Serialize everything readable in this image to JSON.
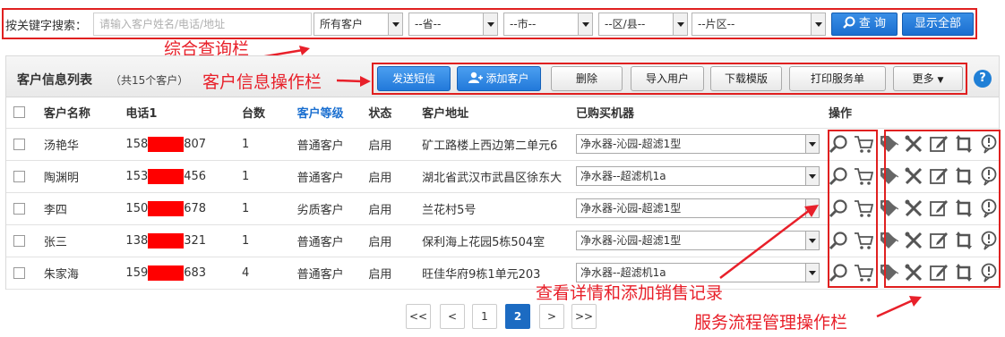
{
  "search": {
    "label": "按关键字搜索：",
    "placeholder": "请输入客户姓名/电话/地址",
    "customer_type": "所有客户",
    "province": "--省--",
    "city": "--市--",
    "district": "--区/县--",
    "area": "--片区--",
    "query_btn": "查 询",
    "show_all_btn": "显示全部"
  },
  "annotations": {
    "search_bar": "综合查询栏",
    "ops_bar": "客户信息操作栏",
    "detail": "查看详情和添加销售记录",
    "service": "服务流程管理操作栏"
  },
  "list": {
    "title": "客户信息列表",
    "count": "（共15个客户）",
    "buttons": {
      "sms": "发送短信",
      "add": "添加客户",
      "delete": "删除",
      "import": "导入用户",
      "download": "下载模版",
      "print": "打印服务单",
      "more": "更多"
    },
    "columns": [
      "客户名称",
      "电话1",
      "台数",
      "客户等级",
      "状态",
      "客户地址",
      "已购买机器",
      "操作"
    ],
    "rows": [
      {
        "name": "汤艳华",
        "phone_a": "158",
        "phone_b": "807",
        "count": "1",
        "level": "普通客户",
        "status": "启用",
        "address": "矿工路楼上西边第二单元6",
        "machine": "净水器-沁园-超滤1型"
      },
      {
        "name": "陶渊明",
        "phone_a": "153",
        "phone_b": "456",
        "count": "1",
        "level": "普通客户",
        "status": "启用",
        "address": "湖北省武汉市武昌区徐东大",
        "machine": "净水器--超滤机1a"
      },
      {
        "name": "李四",
        "phone_a": "150",
        "phone_b": "678",
        "count": "1",
        "level": "劣质客户",
        "status": "启用",
        "address": "兰花村5号",
        "machine": "净水器-沁园-超滤1型"
      },
      {
        "name": "张三",
        "phone_a": "138",
        "phone_b": "321",
        "count": "1",
        "level": "普通客户",
        "status": "启用",
        "address": "保利海上花园5栋504室",
        "machine": "净水器-沁园-超滤1型"
      },
      {
        "name": "朱家海",
        "phone_a": "159",
        "phone_b": "683",
        "count": "4",
        "level": "普通客户",
        "status": "启用",
        "address": "旺佳华府9栋1单元203",
        "machine": "净水器--超滤机1a"
      }
    ]
  },
  "pager": {
    "first": "<<",
    "prev": "<",
    "p1": "1",
    "p2": "2",
    "next": ">",
    "last": ">>"
  },
  "colors": {
    "accent": "#1a6fd0",
    "annotation": "#e8202a"
  }
}
